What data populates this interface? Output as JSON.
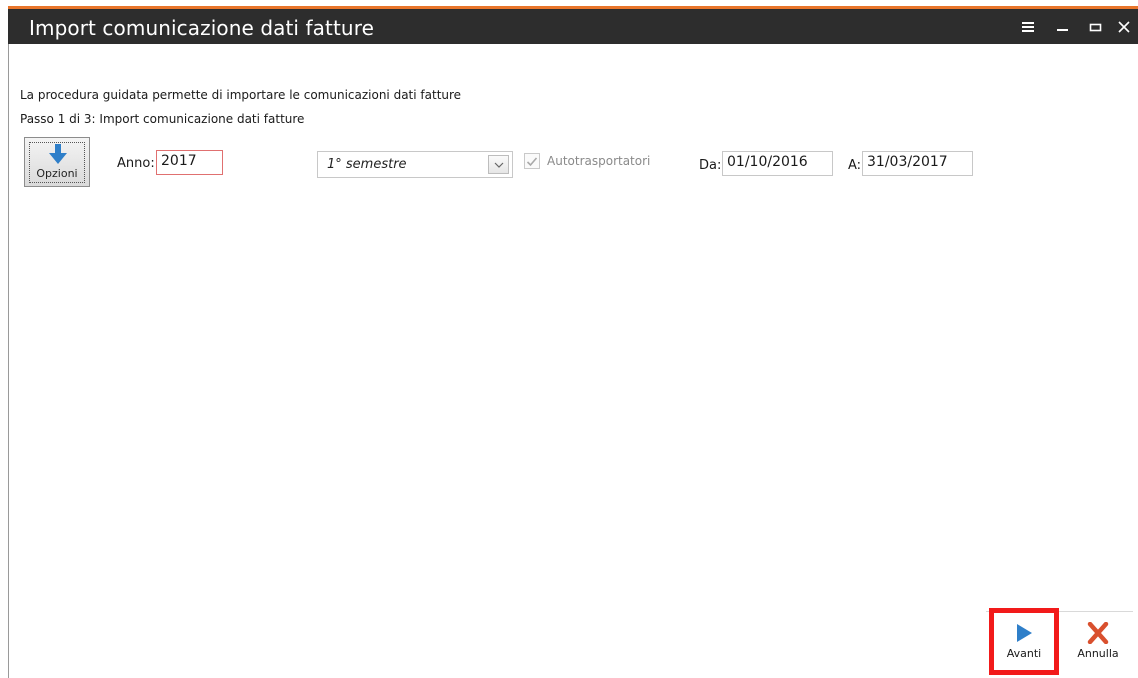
{
  "window": {
    "title": "Import comunicazione dati fatture",
    "controls": [
      "menu-icon",
      "minimize-icon",
      "maximize-icon",
      "close-icon"
    ]
  },
  "wizard": {
    "description": "La procedura guidata permette di importare le comunicazioni dati fatture",
    "step": "Passo 1 di 3: Import comunicazione dati fatture"
  },
  "form": {
    "opzioni_label": "Opzioni",
    "anno_label": "Anno:",
    "anno_value": "2017",
    "periodo_value": "1° semestre",
    "autotrasportatori_label": "Autotrasportatori",
    "autotrasportatori_checked": true,
    "da_label": "Da:",
    "da_value": "01/10/2016",
    "a_label": "A:",
    "a_value": "31/03/2017"
  },
  "toolbar": {
    "avanti_label": "Avanti",
    "annulla_label": "Annulla"
  },
  "colors": {
    "accent": "#e8752b",
    "titlebar": "#2d2d2d",
    "highlight": "#f21a1a",
    "avanti_icon": "#2f7fc9",
    "annulla_icon": "#d9502e"
  }
}
